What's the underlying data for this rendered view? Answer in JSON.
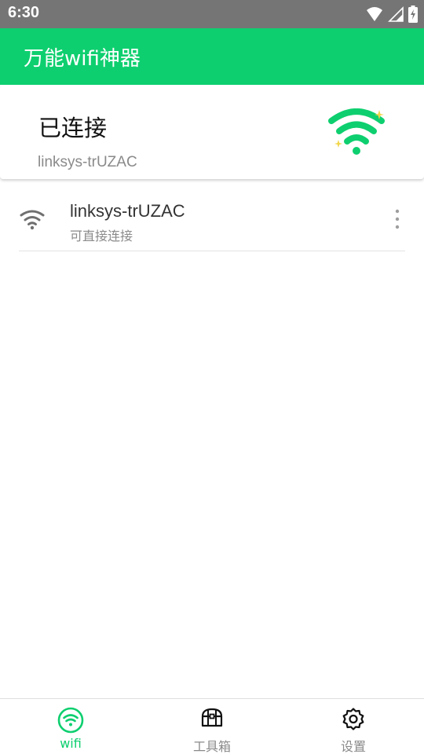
{
  "status_bar": {
    "time": "6:30",
    "icons": [
      "wifi-signal-icon",
      "cell-signal-icon",
      "battery-charging-icon"
    ]
  },
  "app_bar": {
    "title": "万能wifi神器"
  },
  "connected_card": {
    "status": "已连接",
    "ssid": "linksys-trUZAC",
    "icon": "wifi-sparkle-icon"
  },
  "networks": [
    {
      "name": "linksys-trUZAC",
      "description": "可直接连接",
      "icon": "wifi-icon",
      "menu_icon": "more-vertical-icon"
    }
  ],
  "bottom_nav": {
    "items": [
      {
        "label": "wifi",
        "icon": "wifi-circle-icon",
        "active": true
      },
      {
        "label": "工具箱",
        "icon": "toolbox-icon",
        "active": false
      },
      {
        "label": "设置",
        "icon": "settings-gear-icon",
        "active": false
      }
    ]
  },
  "colors": {
    "primary": "#0ecf6f",
    "status_bar": "#757575",
    "secondary_text": "#8a8a8a",
    "primary_text": "#333333"
  }
}
